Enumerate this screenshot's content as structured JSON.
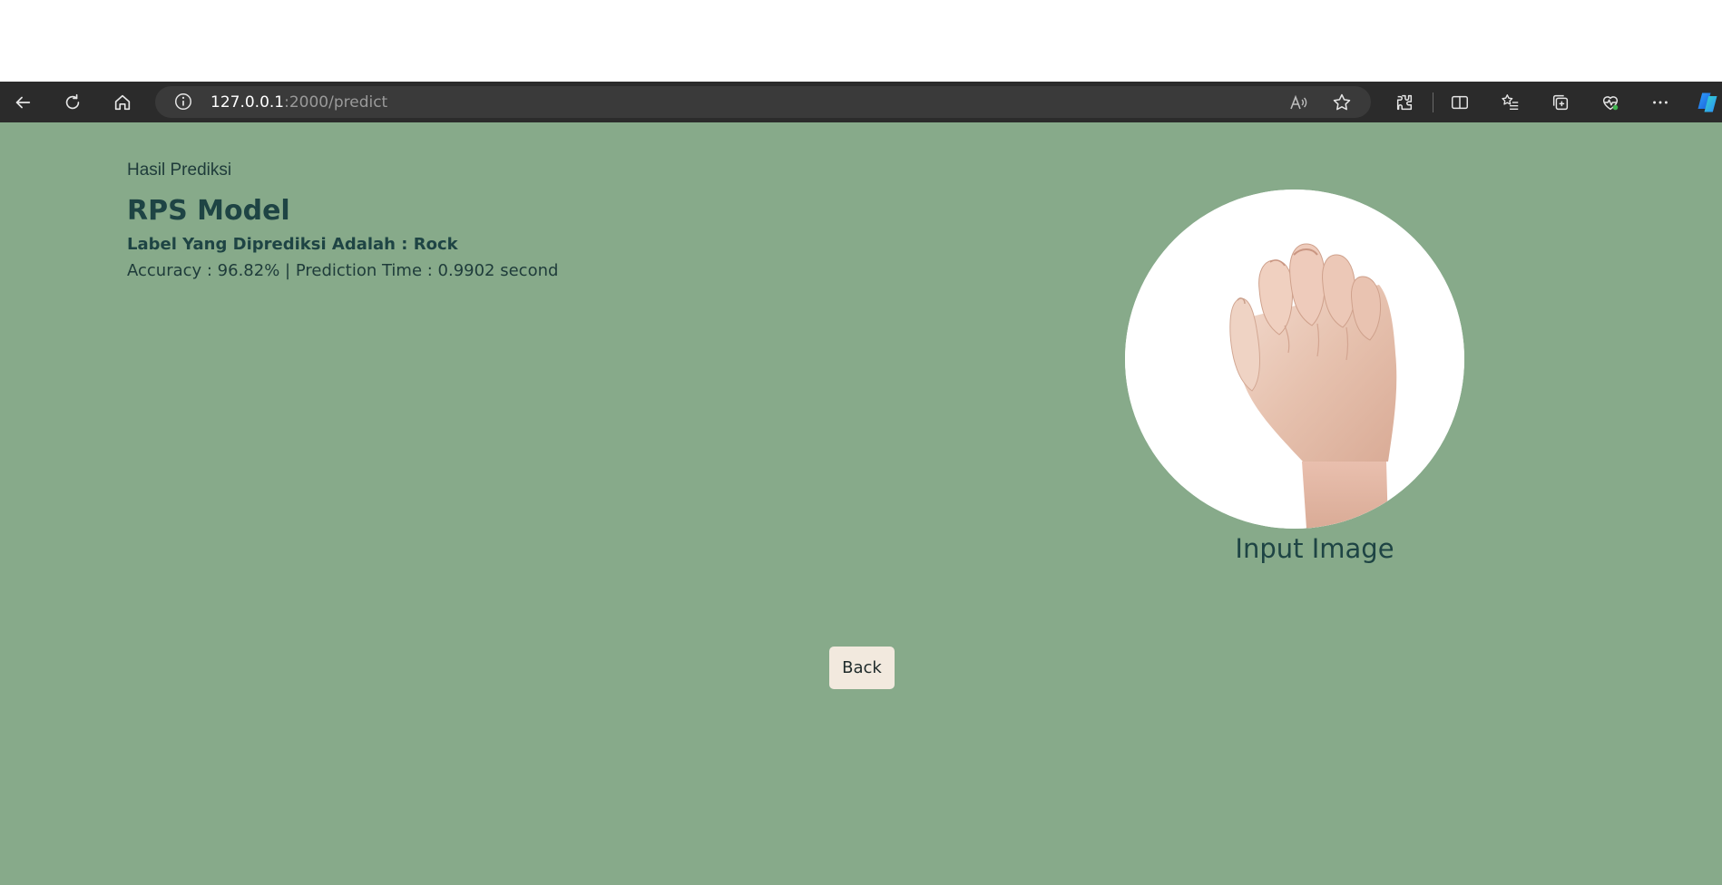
{
  "browser": {
    "url_host": "127.0.0.1",
    "url_rest": ":2000/predict",
    "icons": [
      "back-icon",
      "refresh-icon",
      "home-icon",
      "site-info-icon",
      "read-aloud-icon",
      "favorite-icon",
      "extensions-icon",
      "split-screen-icon",
      "favorites-icon",
      "collections-icon",
      "browser-essentials-icon",
      "more-icon",
      "copilot-icon"
    ]
  },
  "result": {
    "label": "Hasil Prediksi",
    "model_title": "RPS Model",
    "predicted_label": "Label Yang Diprediksi Adalah : Rock",
    "metrics_line": "Accuracy : 96.82% | Prediction Time : 0.9902 second"
  },
  "image": {
    "caption": "Input Image"
  },
  "actions": {
    "back_label": "Back"
  },
  "colors": {
    "page_background": "#87aa8a",
    "heading_text": "#1e4444",
    "button_background": "#f2e9de",
    "browser_bar": "#2b2b2b"
  }
}
